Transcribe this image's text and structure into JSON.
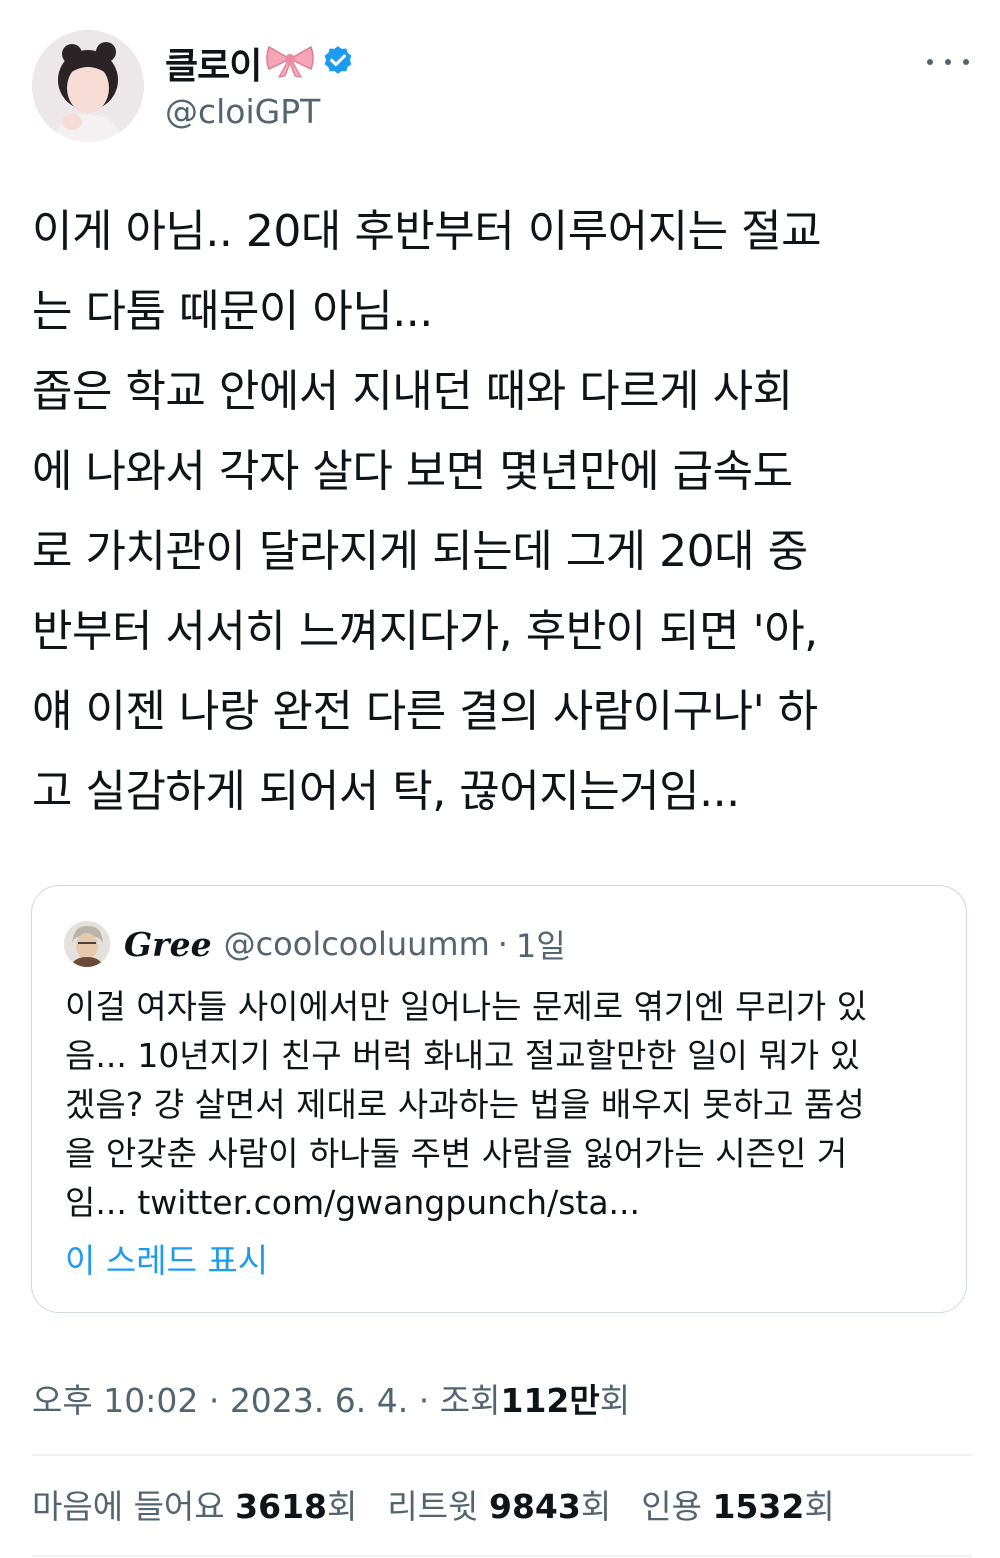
{
  "author": {
    "display_name": "클로이",
    "handle": "@cloiGPT",
    "verified": true,
    "name_emoji": "ribbon-icon"
  },
  "tweet": {
    "text": "이게 아님.. 20대 후반부터 이루어지는 절교\n는 다툼 때문이 아님...\n좁은 학교 안에서 지내던 때와 다르게 사회\n에 나와서 각자 살다 보면 몇년만에 급속도\n로 가치관이 달라지게 되는데 그게 20대 중\n반부터 서서히 느껴지다가, 후반이 되면 '아,\n얘 이젠 나랑 완전 다른 결의 사람이구나' 하\n고 실감하게 되어서 탁, 끊어지는거임..."
  },
  "quote": {
    "name": "Gree",
    "handle": "@coolcooluumm",
    "sep": "·",
    "time": "1일",
    "text": "이걸 여자들 사이에서만 일어나는 문제로 엮기엔 무리가 있\n음... 10년지기 친구 버럭 화내고 절교할만한 일이 뭐가 있\n겠음? 걍 살면서 제대로 사과하는 법을 배우지 못하고 품성\n을 안갖춘 사람이 하나둘 주변 사람을 잃어가는 시즌인 거\n임... twitter.com/gwangpunch/sta...",
    "show_thread": "이 스레드 표시"
  },
  "meta": {
    "time": "오후 10:02",
    "date": "2023. 6. 4.",
    "views_label": "조회",
    "views_value": "112만",
    "views_suffix": "회",
    "sep": "·"
  },
  "stats": {
    "likes_label": "마음에 들어요",
    "likes_value": "3618",
    "retweets_label": "리트윗",
    "retweets_value": "9843",
    "quotes_label": "인용",
    "quotes_value": "1532",
    "suffix": "회"
  },
  "colors": {
    "text": "#0f1419",
    "secondary": "#536471",
    "accent": "#1d9bf0",
    "border": "#cfd9de"
  }
}
